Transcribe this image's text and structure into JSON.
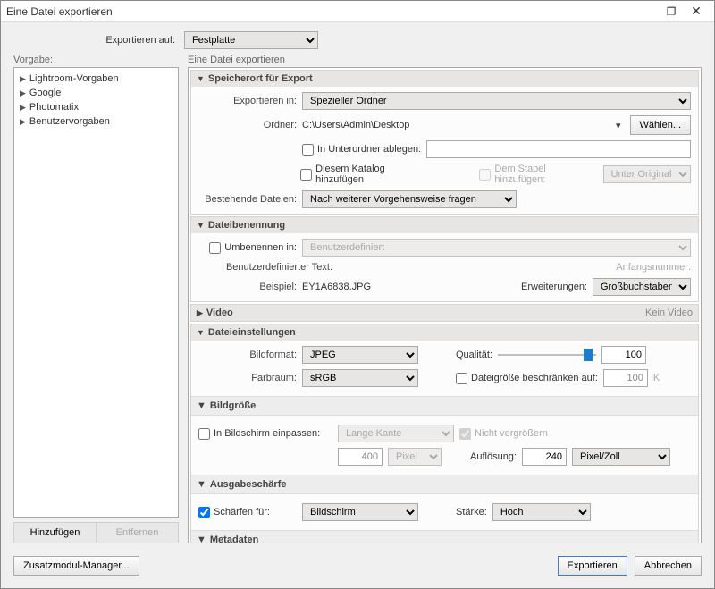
{
  "window": {
    "title": "Eine Datei exportieren",
    "panel_icon": "panel-icon",
    "close_icon": "✕"
  },
  "export_to": {
    "label": "Exportieren auf:",
    "value": "Festplatte"
  },
  "presets": {
    "label": "Vorgabe:",
    "items": [
      {
        "label": "Lightroom-Vorgaben"
      },
      {
        "label": "Google"
      },
      {
        "label": "Photomatix"
      },
      {
        "label": "Benutzervorgaben"
      }
    ],
    "add": "Hinzufügen",
    "remove": "Entfernen"
  },
  "right_label": "Eine Datei exportieren",
  "sections": {
    "location": {
      "title": "Speicherort für Export",
      "export_in_label": "Exportieren in:",
      "export_in_value": "Spezieller Ordner",
      "folder_label": "Ordner:",
      "folder_path": "C:\\Users\\Admin\\Desktop",
      "choose": "Wählen...",
      "subfolder": "In Unterordner ablegen:",
      "add_catalog": "Diesem Katalog hinzufügen",
      "add_stack": "Dem Stapel hinzufügen:",
      "stack_pos": "Unter Original",
      "existing_label": "Bestehende Dateien:",
      "existing_value": "Nach weiterer Vorgehensweise fragen"
    },
    "naming": {
      "title": "Dateibenennung",
      "rename": "Umbenennen in:",
      "template": "Benutzerdefiniert",
      "custom_text": "Benutzerdefinierter Text:",
      "start_num": "Anfangsnummer:",
      "example_label": "Beispiel:",
      "example_value": "EY1A6838.JPG",
      "ext_label": "Erweiterungen:",
      "ext_value": "Großbuchstaben"
    },
    "video": {
      "title": "Video",
      "status": "Kein Video"
    },
    "file": {
      "title": "Dateieinstellungen",
      "format_label": "Bildformat:",
      "format_value": "JPEG",
      "quality_label": "Qualität:",
      "quality_value": "100",
      "space_label": "Farbraum:",
      "space_value": "sRGB",
      "limit_label": "Dateigröße beschränken auf:",
      "limit_value": "100",
      "limit_unit": "K"
    },
    "size": {
      "title": "Bildgröße",
      "fit": "In Bildschirm einpassen:",
      "fit_mode": "Lange Kante",
      "dont_enlarge": "Nicht vergrößern",
      "dim": "400",
      "dim_unit": "Pixel",
      "res_label": "Auflösung:",
      "res_value": "240",
      "res_unit": "Pixel/Zoll"
    },
    "sharpen": {
      "title": "Ausgabeschärfe",
      "sharpen_for": "Schärfen für:",
      "target": "Bildschirm",
      "amount_label": "Stärke:",
      "amount_value": "Hoch"
    },
    "metadata": {
      "title": "Metadaten"
    }
  },
  "footer": {
    "plugin_mgr": "Zusatzmodul-Manager...",
    "export": "Exportieren",
    "cancel": "Abbrechen"
  }
}
